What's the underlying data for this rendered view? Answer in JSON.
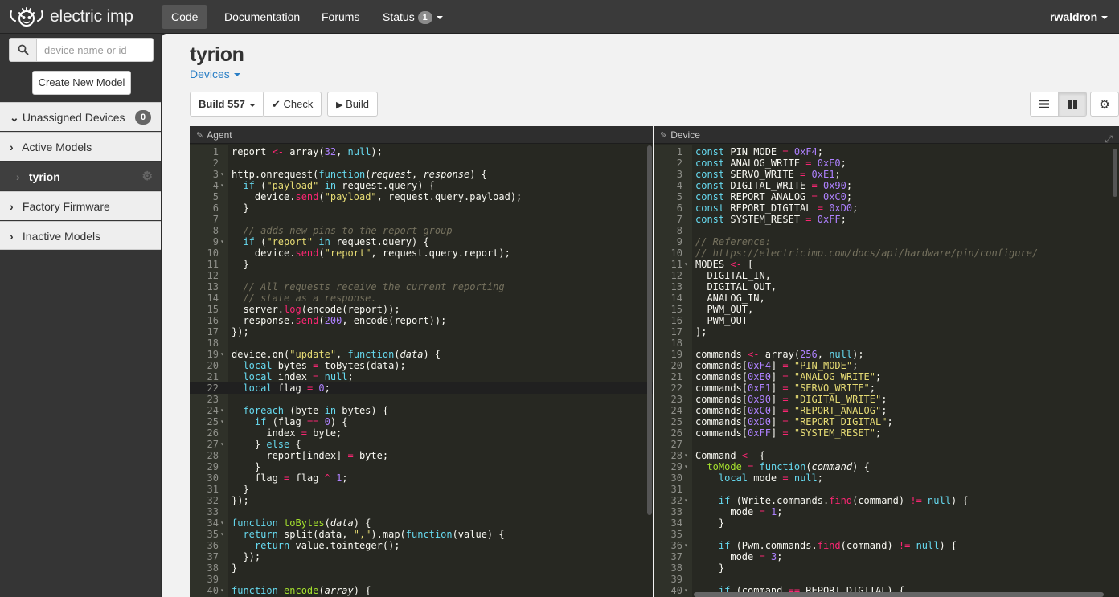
{
  "brand": {
    "name": "electric imp"
  },
  "nav": {
    "code": "Code",
    "documentation": "Documentation",
    "forums": "Forums",
    "status": "Status",
    "status_count": "1",
    "user": "rwaldron"
  },
  "sidebar": {
    "search_placeholder": "device name or id",
    "create_button": "Create New Model",
    "items": [
      {
        "label": "Unassigned Devices",
        "count": "0",
        "expanded": true
      },
      {
        "label": "Active Models"
      },
      {
        "label": "tyrion",
        "selected": true
      },
      {
        "label": "Factory Firmware"
      },
      {
        "label": "Inactive Models"
      }
    ]
  },
  "main": {
    "title": "tyrion",
    "devices_link": "Devices",
    "build_button": "Build 557",
    "check_button": "Check",
    "run_button": "Build"
  },
  "editors": {
    "agent": {
      "label": "Agent",
      "cursor_line": 22,
      "lines": [
        {
          "n": 1,
          "t": "report <- array(32, null);"
        },
        {
          "n": 2,
          "t": ""
        },
        {
          "n": 3,
          "t": "http.onrequest(function(request, response) {",
          "f": true
        },
        {
          "n": 4,
          "t": "  if (\"payload\" in request.query) {",
          "f": true
        },
        {
          "n": 5,
          "t": "    device.send(\"payload\", request.query.payload);"
        },
        {
          "n": 6,
          "t": "  }"
        },
        {
          "n": 7,
          "t": ""
        },
        {
          "n": 8,
          "t": "  // adds new pins to the report group"
        },
        {
          "n": 9,
          "t": "  if (\"report\" in request.query) {",
          "f": true
        },
        {
          "n": 10,
          "t": "    device.send(\"report\", request.query.report);"
        },
        {
          "n": 11,
          "t": "  }"
        },
        {
          "n": 12,
          "t": ""
        },
        {
          "n": 13,
          "t": "  // All requests receive the current reporting"
        },
        {
          "n": 14,
          "t": "  // state as a response."
        },
        {
          "n": 15,
          "t": "  server.log(encode(report));"
        },
        {
          "n": 16,
          "t": "  response.send(200, encode(report));"
        },
        {
          "n": 17,
          "t": "});"
        },
        {
          "n": 18,
          "t": ""
        },
        {
          "n": 19,
          "t": "device.on(\"update\", function(data) {",
          "f": true
        },
        {
          "n": 20,
          "t": "  local bytes = toBytes(data);"
        },
        {
          "n": 21,
          "t": "  local index = null;"
        },
        {
          "n": 22,
          "t": "  local flag = 0;"
        },
        {
          "n": 23,
          "t": ""
        },
        {
          "n": 24,
          "t": "  foreach (byte in bytes) {",
          "f": true
        },
        {
          "n": 25,
          "t": "    if (flag == 0) {",
          "f": true
        },
        {
          "n": 26,
          "t": "      index = byte;"
        },
        {
          "n": 27,
          "t": "    } else {",
          "f": true
        },
        {
          "n": 28,
          "t": "      report[index] = byte;"
        },
        {
          "n": 29,
          "t": "    }"
        },
        {
          "n": 30,
          "t": "    flag = flag ^ 1;"
        },
        {
          "n": 31,
          "t": "  }"
        },
        {
          "n": 32,
          "t": "});"
        },
        {
          "n": 33,
          "t": ""
        },
        {
          "n": 34,
          "t": "function toBytes(data) {",
          "f": true
        },
        {
          "n": 35,
          "t": "  return split(data, \",\").map(function(value) {",
          "f": true
        },
        {
          "n": 36,
          "t": "    return value.tointeger();"
        },
        {
          "n": 37,
          "t": "  });"
        },
        {
          "n": 38,
          "t": "}"
        },
        {
          "n": 39,
          "t": ""
        },
        {
          "n": 40,
          "t": "function encode(array) {",
          "f": true
        }
      ]
    },
    "device": {
      "label": "Device",
      "lines": [
        {
          "n": 1,
          "t": "const PIN_MODE = 0xF4;"
        },
        {
          "n": 2,
          "t": "const ANALOG_WRITE = 0xE0;"
        },
        {
          "n": 3,
          "t": "const SERVO_WRITE = 0xE1;"
        },
        {
          "n": 4,
          "t": "const DIGITAL_WRITE = 0x90;"
        },
        {
          "n": 5,
          "t": "const REPORT_ANALOG = 0xC0;"
        },
        {
          "n": 6,
          "t": "const REPORT_DIGITAL = 0xD0;"
        },
        {
          "n": 7,
          "t": "const SYSTEM_RESET = 0xFF;"
        },
        {
          "n": 8,
          "t": ""
        },
        {
          "n": 9,
          "t": "// Reference:"
        },
        {
          "n": 10,
          "t": "// https://electricimp.com/docs/api/hardware/pin/configure/"
        },
        {
          "n": 11,
          "t": "MODES <- [",
          "f": true
        },
        {
          "n": 12,
          "t": "  DIGITAL_IN,"
        },
        {
          "n": 13,
          "t": "  DIGITAL_OUT,"
        },
        {
          "n": 14,
          "t": "  ANALOG_IN,"
        },
        {
          "n": 15,
          "t": "  PWM_OUT,"
        },
        {
          "n": 16,
          "t": "  PWM_OUT"
        },
        {
          "n": 17,
          "t": "];"
        },
        {
          "n": 18,
          "t": ""
        },
        {
          "n": 19,
          "t": "commands <- array(256, null);"
        },
        {
          "n": 20,
          "t": "commands[0xF4] = \"PIN_MODE\";"
        },
        {
          "n": 21,
          "t": "commands[0xE0] = \"ANALOG_WRITE\";"
        },
        {
          "n": 22,
          "t": "commands[0xE1] = \"SERVO_WRITE\";"
        },
        {
          "n": 23,
          "t": "commands[0x90] = \"DIGITAL_WRITE\";"
        },
        {
          "n": 24,
          "t": "commands[0xC0] = \"REPORT_ANALOG\";"
        },
        {
          "n": 25,
          "t": "commands[0xD0] = \"REPORT_DIGITAL\";"
        },
        {
          "n": 26,
          "t": "commands[0xFF] = \"SYSTEM_RESET\";"
        },
        {
          "n": 27,
          "t": ""
        },
        {
          "n": 28,
          "t": "Command <- {",
          "f": true
        },
        {
          "n": 29,
          "t": "  toMode = function(command) {",
          "f": true
        },
        {
          "n": 30,
          "t": "    local mode = null;"
        },
        {
          "n": 31,
          "t": ""
        },
        {
          "n": 32,
          "t": "    if (Write.commands.find(command) != null) {",
          "f": true
        },
        {
          "n": 33,
          "t": "      mode = 1;"
        },
        {
          "n": 34,
          "t": "    }"
        },
        {
          "n": 35,
          "t": ""
        },
        {
          "n": 36,
          "t": "    if (Pwm.commands.find(command) != null) {",
          "f": true
        },
        {
          "n": 37,
          "t": "      mode = 3;"
        },
        {
          "n": 38,
          "t": "    }"
        },
        {
          "n": 39,
          "t": ""
        },
        {
          "n": 40,
          "t": "    if (command == REPORT_DIGITAL) {",
          "f": true
        }
      ]
    }
  },
  "colors": {
    "editor_bg": "#272822",
    "keyword": "#66d9ef",
    "operator": "#f92672",
    "string": "#e6db74",
    "number": "#ae81ff",
    "comment": "#75715e",
    "function_name": "#a6e22e",
    "link": "#2a7fc6"
  }
}
